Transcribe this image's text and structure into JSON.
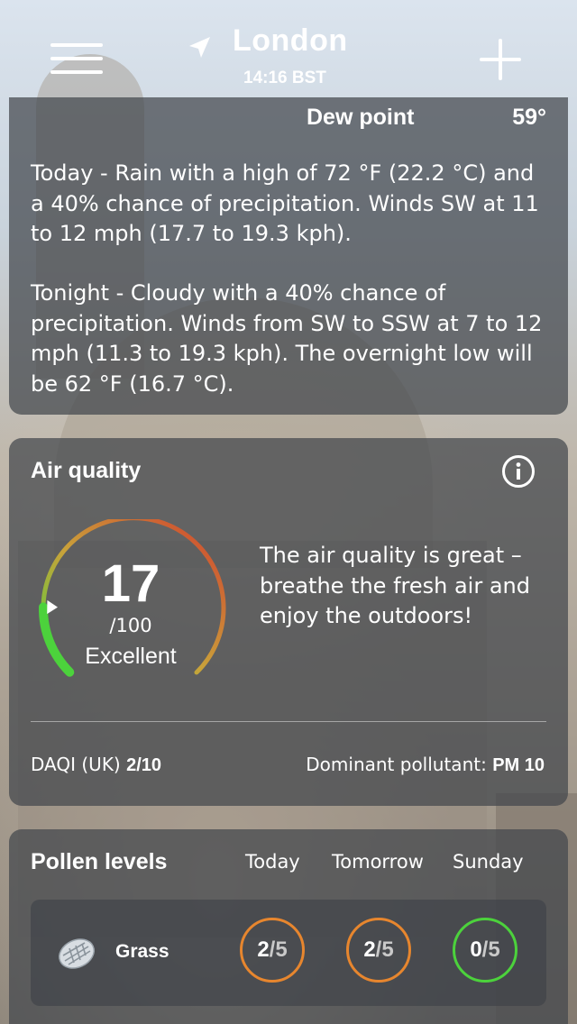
{
  "header": {
    "city": "London",
    "time": "14:16 BST",
    "menu_icon": "hamburger-menu-icon",
    "location_icon": "location-arrow-icon",
    "add_icon": "plus-icon"
  },
  "details": {
    "dew_point_label": "Dew point",
    "dew_point_value": "59°",
    "today_text": "Today - Rain with a high of 72 °F (22.2 °C) and a 40% chance of precipitation. Winds SW at 11 to 12 mph (17.7 to 19.3 kph).",
    "tonight_text": "Tonight - Cloudy with a 40% chance of precipitation. Winds from SW to SSW at 7 to 12 mph (11.3 to 19.3 kph). The overnight low will be 62 °F (16.7 °C)."
  },
  "air_quality": {
    "title": "Air quality",
    "info_icon": "info-icon",
    "index_value": "17",
    "index_max": "/100",
    "index_fraction": 0.17,
    "rating": "Excellent",
    "description": "The air quality is great – breathe the fresh air and enjoy the outdoors!",
    "daqi_label": "DAQI (UK)",
    "daqi_value": "2/10",
    "pollutant_label": "Dominant pollutant:",
    "pollutant_value": "PM 10",
    "gauge_colors": {
      "good": "#4cd23c",
      "mid": "#c9a23a",
      "bad": "#d0402f"
    }
  },
  "pollen": {
    "title": "Pollen levels",
    "days": [
      "Today",
      "Tomorrow",
      "Sunday"
    ],
    "grass": {
      "label": "Grass",
      "icon": "grass-pollen-icon",
      "levels": [
        {
          "value": "2",
          "max": "/5",
          "color": "#e7862e"
        },
        {
          "value": "2",
          "max": "/5",
          "color": "#e7862e"
        },
        {
          "value": "0",
          "max": "/5",
          "color": "#4cd23c"
        }
      ]
    }
  }
}
